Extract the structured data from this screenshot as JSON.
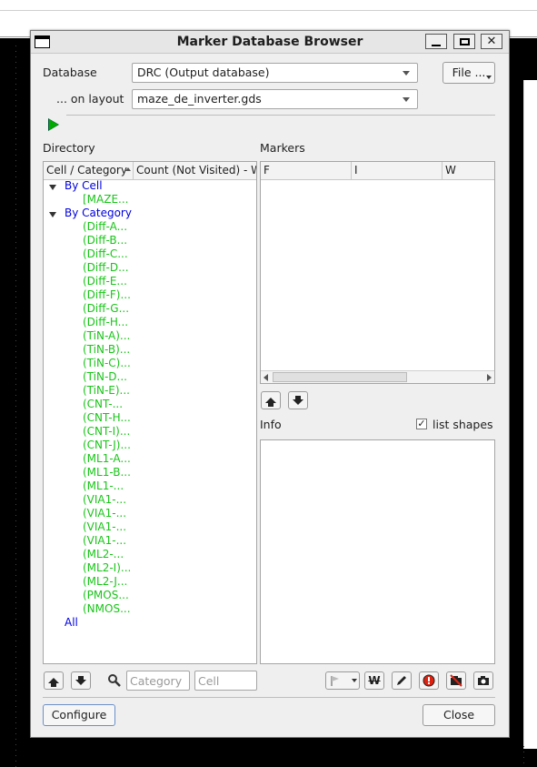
{
  "window": {
    "title": "Marker Database Browser"
  },
  "database": {
    "label": "Database",
    "value": "DRC (Output database)",
    "file_button": "File ..."
  },
  "layout": {
    "label": "... on layout",
    "value": "maze_de_inverter.gds"
  },
  "directory": {
    "title": "Directory",
    "columns": [
      "Cell / Category",
      "Count (Not Visited) - W"
    ],
    "by_cell": {
      "label": "By Cell",
      "items": [
        "[MAZE..."
      ]
    },
    "by_category": {
      "label": "By Category",
      "items": [
        "(Diff-A...",
        "(Diff-B...",
        "(Diff-C...",
        "(Diff-D...",
        "(Diff-E...",
        "(Diff-F)...",
        "(Diff-G...",
        "(Diff-H...",
        "(TiN-A)...",
        "(TiN-B)...",
        "(TiN-C)...",
        "(TiN-D...",
        "(TiN-E)...",
        "(CNT-...",
        "(CNT-H...",
        "(CNT-I)...",
        "(CNT-J)...",
        "(ML1-A...",
        "(ML1-B...",
        "(ML1-...",
        "(VIA1-...",
        "(VIA1-...",
        "(VIA1-...",
        "(VIA1-...",
        "(ML2-...",
        "(ML2-I)...",
        "(ML2-J...",
        "(PMOS...",
        "(NMOS..."
      ]
    },
    "all_label": "All",
    "category_placeholder": "Category",
    "cell_placeholder": "Cell"
  },
  "markers": {
    "title": "Markers",
    "columns": [
      "F",
      "I",
      "W"
    ]
  },
  "info": {
    "title": "Info",
    "list_shapes_label": "list shapes",
    "list_shapes_checked": true,
    "check_glyph": "✓"
  },
  "footer": {
    "configure": "Configure",
    "close": "Close"
  },
  "icons": {
    "close_glyph": "✕"
  }
}
